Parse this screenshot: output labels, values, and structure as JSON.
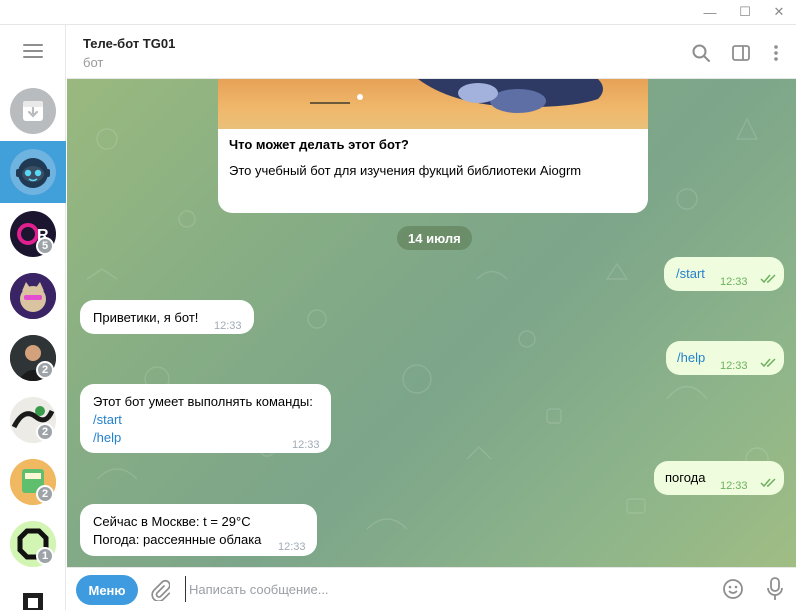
{
  "window": {
    "minimize_glyph": "—",
    "maximize_glyph": "☐",
    "close_glyph": "✕"
  },
  "sidebar": {
    "chats": [
      {
        "name": "archive",
        "badge": ""
      },
      {
        "name": "tele-bot-tg01",
        "badge": ""
      },
      {
        "name": "chat-2",
        "badge": "5"
      },
      {
        "name": "chat-3",
        "badge": ""
      },
      {
        "name": "chat-4",
        "badge": "2"
      },
      {
        "name": "chat-5",
        "badge": "2"
      },
      {
        "name": "chat-6",
        "badge": "2"
      },
      {
        "name": "chat-7",
        "badge": "1"
      }
    ]
  },
  "header": {
    "title": "Теле-бот TG01",
    "status": "бот"
  },
  "bot_card": {
    "title": "Что может делать этот бот?",
    "text": "Это учебный бот для изучения фукций библиотеки Aiogrm"
  },
  "date_separator": "14 июля",
  "messages": [
    {
      "direction": "out",
      "text": "/start",
      "time": "12:33"
    },
    {
      "direction": "in",
      "text": "Приветики, я бот!",
      "time": "12:33"
    },
    {
      "direction": "out",
      "text": "/help",
      "time": "12:33"
    },
    {
      "direction": "in",
      "lines": [
        "Этот бот умеет выполнять команды:",
        "/start",
        "/help"
      ],
      "time": "12:33"
    },
    {
      "direction": "out",
      "text": "погода",
      "time": "12:33"
    },
    {
      "direction": "in",
      "lines": [
        "Сейчас в Москве: t = 29°C",
        "Погода: рассеянные облака"
      ],
      "time": "12:33"
    }
  ],
  "composer": {
    "menu_label": "Меню",
    "placeholder": "Написать сообщение..."
  },
  "colors": {
    "accent": "#3f9be0",
    "active_chat": "#419fd9",
    "outgoing_bubble": "#effdde",
    "link": "#2481cc"
  },
  "icons": [
    "hamburger-icon",
    "archive-icon",
    "search-icon",
    "sidebar-toggle-icon",
    "more-icon",
    "attach-icon",
    "emoji-icon",
    "microphone-icon",
    "double-check-icon"
  ]
}
